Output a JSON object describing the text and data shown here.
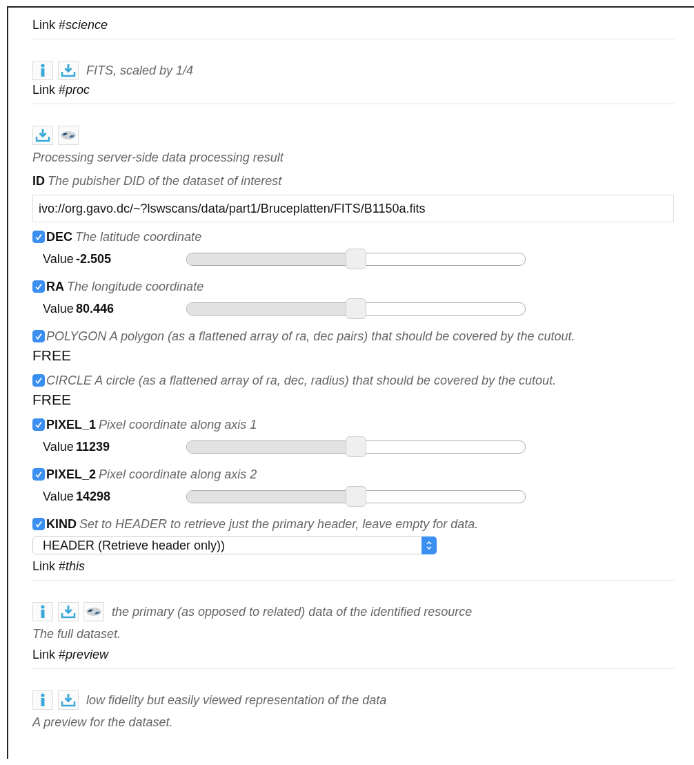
{
  "blocks": [
    {
      "kind": "link",
      "text": "Link #*science*"
    },
    {
      "kind": "actions",
      "buttons": [
        {
          "kind": "info"
        },
        {
          "kind": "download"
        }
      ],
      "text": "FITS, scaled by 1/4"
    },
    {
      "kind": "link",
      "text": "Link #*proc*"
    },
    {
      "kind": "actions",
      "buttons": [
        {
          "kind": "download"
        },
        {
          "kind": "processing"
        }
      ]
    },
    {
      "kind": "note",
      "text": "Processing server-side data processing result"
    },
    {
      "kind": "param",
      "name": "ID",
      "description": "The pubisher DID of the dataset of interest",
      "control": {
        "kind": "text",
        "value": "ivo://org.gavo.dc/~?lswscans/data/part1/Bruceplatten/FITS/B1150a.fits"
      }
    },
    {
      "kind": "param",
      "checked": true,
      "name": "DEC",
      "description": "The latitude coordinate",
      "control": {
        "kind": "slider",
        "label": "Value",
        "value": "-2.505",
        "level": 0.5
      }
    },
    {
      "kind": "param",
      "checked": true,
      "name": "RA",
      "description": "The longitude coordinate",
      "control": {
        "kind": "slider",
        "label": "Value",
        "value": "80.446",
        "level": 0.5
      }
    },
    {
      "kind": "param",
      "checked": true,
      "description": "POLYGON A polygon (as a flattened array of ra, dec pairs) that should be covered by the cutout.",
      "control": {
        "kind": "free",
        "text": "FREE"
      }
    },
    {
      "kind": "param",
      "checked": true,
      "description": "CIRCLE A circle (as a flattened array of ra, dec, radius) that should be covered by the cutout.",
      "control": {
        "kind": "free",
        "text": "FREE"
      }
    },
    {
      "kind": "param",
      "checked": true,
      "name": "PIXEL_1",
      "description": "Pixel coordinate along axis 1",
      "control": {
        "kind": "slider",
        "label": "Value",
        "value": "11239",
        "level": 0.5
      }
    },
    {
      "kind": "param",
      "checked": true,
      "name": "PIXEL_2",
      "description": "Pixel coordinate along axis 2",
      "control": {
        "kind": "slider",
        "label": "Value",
        "value": "14298",
        "level": 0.5
      }
    },
    {
      "kind": "param",
      "checked": true,
      "name": "KIND",
      "description": "Set to HEADER to retrieve just the primary header, leave empty for data.",
      "control": {
        "kind": "select",
        "value": "HEADER (Retrieve header only))"
      }
    },
    {
      "kind": "link",
      "text": "Link #*this*"
    },
    {
      "kind": "actions",
      "buttons": [
        {
          "kind": "info"
        },
        {
          "kind": "download"
        },
        {
          "kind": "processing"
        }
      ],
      "text": "the primary (as opposed to related) data of the identified resource"
    },
    {
      "kind": "note",
      "text": "The full dataset."
    },
    {
      "kind": "link",
      "text": "Link #*preview*"
    },
    {
      "kind": "actions",
      "buttons": [
        {
          "kind": "info"
        },
        {
          "kind": "download"
        }
      ],
      "text": "low fidelity but easily viewed representation of the data"
    },
    {
      "kind": "note",
      "text": "A preview for the dataset."
    }
  ]
}
